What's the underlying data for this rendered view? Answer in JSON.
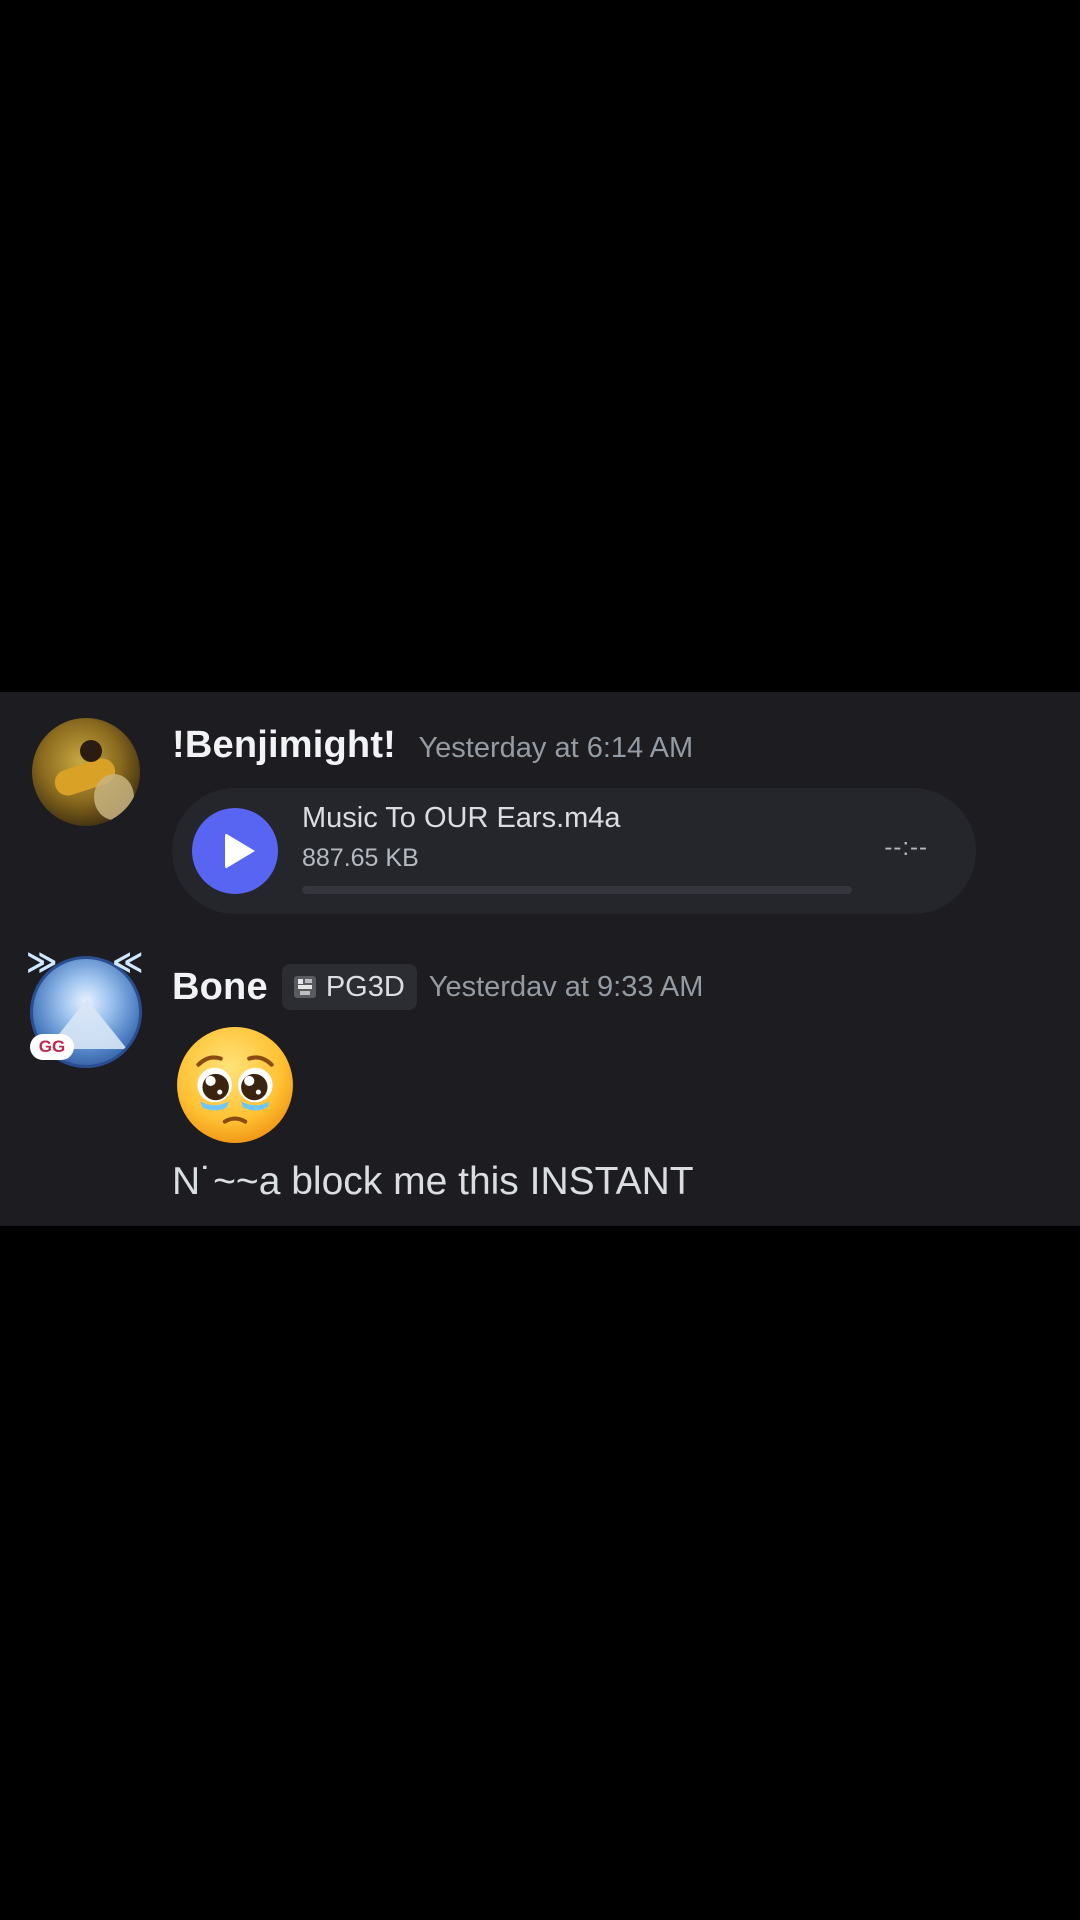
{
  "messages": [
    {
      "username": "!Benjimight!",
      "timestamp": "Yesterday at 6:14 AM",
      "attachment": {
        "icon": "play-icon",
        "filename": "Music To OUR Ears.m4a",
        "size": "887.65 KB",
        "duration": "--:--",
        "progress": 0
      }
    },
    {
      "username": "Bone",
      "tag": "PG3D",
      "tag_icon": "pg3d-guild-icon",
      "timestamp": "Yesterdav at 9:33 AM",
      "avatar_badge": "GG",
      "emoji": "pleading-face-emoji",
      "text": "N˙~~a block me this INSTANT"
    }
  ],
  "colors": {
    "background": "#000000",
    "chat_background": "#1c1c21",
    "accent": "#5865f2"
  }
}
